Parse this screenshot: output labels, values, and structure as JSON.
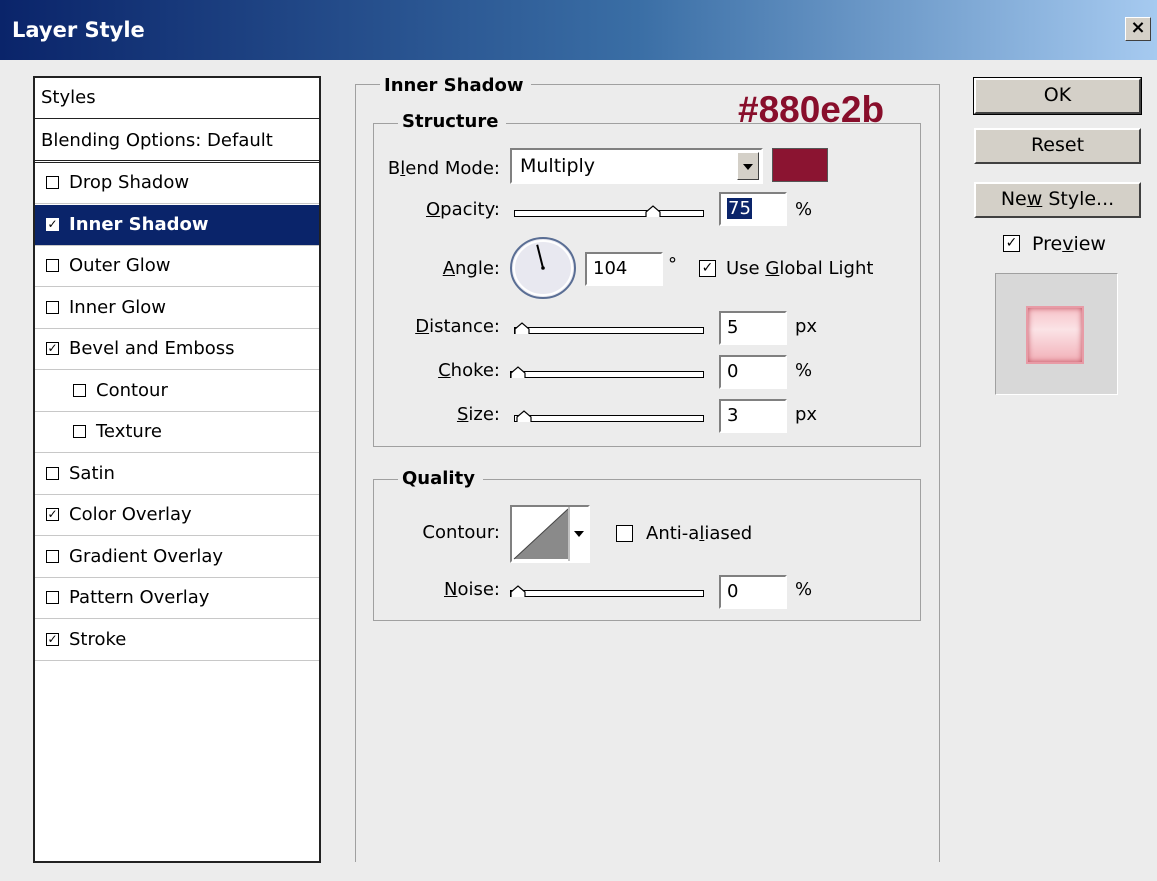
{
  "window": {
    "title": "Layer Style",
    "close_glyph": "×"
  },
  "styles_list": {
    "header": "Styles",
    "blending": "Blending Options: Default",
    "items": [
      {
        "label": "Drop Shadow",
        "checked": false,
        "indent": false,
        "selected": false
      },
      {
        "label": "Inner Shadow",
        "checked": true,
        "indent": false,
        "selected": true
      },
      {
        "label": "Outer Glow",
        "checked": false,
        "indent": false,
        "selected": false
      },
      {
        "label": "Inner Glow",
        "checked": false,
        "indent": false,
        "selected": false
      },
      {
        "label": "Bevel and Emboss",
        "checked": true,
        "indent": false,
        "selected": false
      },
      {
        "label": "Contour",
        "checked": false,
        "indent": true,
        "selected": false
      },
      {
        "label": "Texture",
        "checked": false,
        "indent": true,
        "selected": false
      },
      {
        "label": "Satin",
        "checked": false,
        "indent": false,
        "selected": false
      },
      {
        "label": "Color Overlay",
        "checked": true,
        "indent": false,
        "selected": false
      },
      {
        "label": "Gradient Overlay",
        "checked": false,
        "indent": false,
        "selected": false
      },
      {
        "label": "Pattern Overlay",
        "checked": false,
        "indent": false,
        "selected": false
      },
      {
        "label": "Stroke",
        "checked": true,
        "indent": false,
        "selected": false
      }
    ]
  },
  "panel": {
    "title": "Inner Shadow",
    "annotation": "#880e2b",
    "structure": {
      "legend": "Structure",
      "blend_mode": {
        "label_pre": "B",
        "label_u": "l",
        "label_post": "end Mode:",
        "value": "Multiply"
      },
      "shadow_color": "#8b1431",
      "opacity": {
        "label_u": "O",
        "label_post": "pacity:",
        "value": "75",
        "unit": "%",
        "level": 0.75
      },
      "angle": {
        "label_u": "A",
        "label_post": "ngle:",
        "value": "104",
        "unit": "°",
        "degrees": 104
      },
      "global_light": {
        "checked": true,
        "label_pre": "Use ",
        "label_u": "G",
        "label_post": "lobal Light"
      },
      "distance": {
        "label_u": "D",
        "label_post": "istance:",
        "value": "5",
        "unit": "px",
        "level": 0.0
      },
      "choke": {
        "label_u": "C",
        "label_post": "hoke:",
        "value": "0",
        "unit": "%",
        "level": 0.0
      },
      "size": {
        "label_u": "S",
        "label_post": "ize:",
        "value": "3",
        "unit": "px",
        "level": 0.01
      }
    },
    "quality": {
      "legend": "Quality",
      "contour_label": "Contour:",
      "anti_aliased": {
        "checked": false,
        "label_pre": "Anti-a",
        "label_u": "l",
        "label_post": "iased"
      },
      "noise": {
        "label_u": "N",
        "label_post": "oise:",
        "value": "0",
        "unit": "%",
        "level": 0.0
      }
    }
  },
  "buttons": {
    "ok": "OK",
    "reset": "Reset",
    "new_style_pre": "Ne",
    "new_style_u": "w",
    "new_style_post": " Style...",
    "preview_pre": "Pre",
    "preview_u": "v",
    "preview_post": "iew",
    "preview_checked": true
  },
  "check_glyph": "✓"
}
